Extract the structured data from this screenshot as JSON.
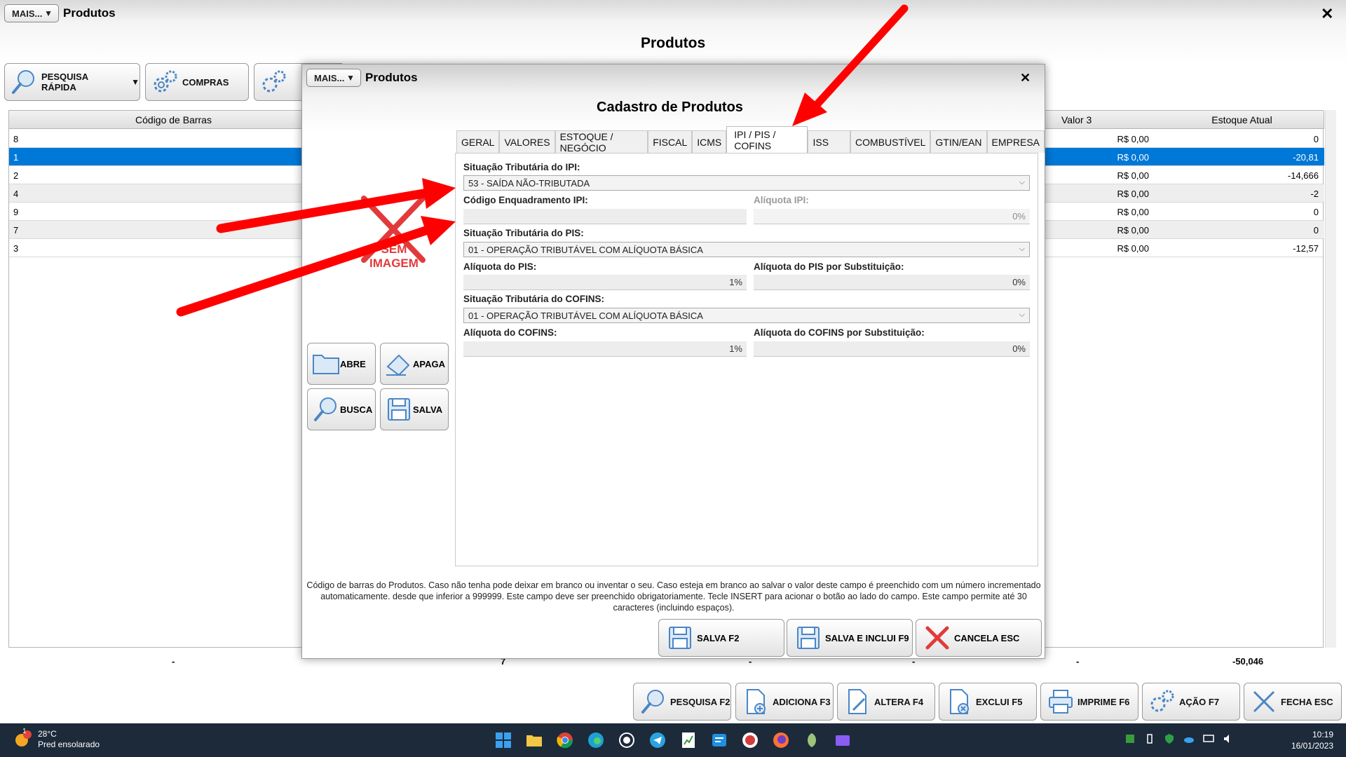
{
  "main": {
    "mais_label": "MAIS...",
    "window_title": "Produtos",
    "page_title": "Produtos",
    "toolbar": {
      "pesquisa_rapida": "PESQUISA RÁPIDA",
      "compras": "COMPRAS"
    }
  },
  "grid": {
    "headers": {
      "codigo_barras": "Código de Barras",
      "valor3": "Valor 3",
      "estoque_atual": "Estoque Atual"
    },
    "rows": [
      {
        "codigo": "8",
        "valor3": "R$ 0,00",
        "estoque": "0"
      },
      {
        "codigo": "1",
        "valor3": "R$ 0,00",
        "estoque": "-20,81"
      },
      {
        "codigo": "2",
        "valor3": "R$ 0,00",
        "estoque": "-14,666"
      },
      {
        "codigo": "4",
        "valor3": "R$ 0,00",
        "estoque": "-2"
      },
      {
        "codigo": "9",
        "valor3": "R$ 0,00",
        "estoque": "0"
      },
      {
        "codigo": "7",
        "valor3": "R$ 0,00",
        "estoque": "0"
      },
      {
        "codigo": "3",
        "valor3": "R$ 0,00",
        "estoque": "-12,57"
      }
    ],
    "totals": {
      "t1": "-",
      "t2": "7",
      "t3": "-",
      "t4": "-",
      "t5": "-",
      "t6": "-50,046"
    }
  },
  "bottom_buttons": {
    "pesquisa": "PESQUISA F2",
    "adiciona": "ADICIONA F3",
    "altera": "ALTERA F4",
    "exclui": "EXCLUI F5",
    "imprime": "IMPRIME F6",
    "acao": "AÇÃO F7",
    "fecha": "FECHA ESC"
  },
  "dialog": {
    "mais_label": "MAIS...",
    "window_title": "Produtos",
    "title": "Cadastro de Produtos",
    "tabs": [
      "GERAL",
      "VALORES",
      "ESTOQUE / NEGÓCIO",
      "FISCAL",
      "ICMS",
      "IPI / PIS / COFINS",
      "ISS",
      "COMBUSTÍVEL",
      "GTIN/EAN",
      "EMPRESA"
    ],
    "no_image_text_1": "SEM",
    "no_image_text_2": "IMAGEM",
    "side_buttons": {
      "abre": "ABRE",
      "apaga": "APAGA",
      "busca": "BUSCA",
      "salva": "SALVA"
    },
    "fields": {
      "sit_ipi_label": "Situação Tributária do IPI:",
      "sit_ipi_value": "53 - SAÍDA NÃO-TRIBUTADA",
      "cod_enq_label": "Código Enquadramento IPI:",
      "cod_enq_value": "",
      "aliq_ipi_label": "Alíquota IPI:",
      "aliq_ipi_value": "0%",
      "sit_pis_label": "Situação Tributária do PIS:",
      "sit_pis_value": "01 - OPERAÇÃO TRIBUTÁVEL COM ALÍQUOTA BÁSICA",
      "aliq_pis_label": "Alíquota do PIS:",
      "aliq_pis_value": "1%",
      "aliq_pis_sub_label": "Alíquota do PIS por Substituição:",
      "aliq_pis_sub_value": "0%",
      "sit_cofins_label": "Situação Tributária do COFINS:",
      "sit_cofins_value": "01 - OPERAÇÃO TRIBUTÁVEL COM ALÍQUOTA BÁSICA",
      "aliq_cofins_label": "Alíquota do COFINS:",
      "aliq_cofins_value": "1%",
      "aliq_cofins_sub_label": "Alíquota do COFINS por Substituição:",
      "aliq_cofins_sub_value": "0%"
    },
    "help_text": "Código de barras do Produtos. Caso não tenha pode deixar em branco ou inventar o seu. Caso esteja em branco ao salvar o valor deste campo é preenchido com um número incrementado automaticamente. desde que inferior a 999999. Este campo deve ser preenchido obrigatoriamente. Tecle INSERT para acionar o botão ao lado do campo. Este campo permite até 30 caracteres (incluindo espaços).",
    "buttons": {
      "salva": "SALVA F2",
      "salva_inclui": "SALVA E INCLUI F9",
      "cancela": "CANCELA ESC"
    }
  },
  "taskbar": {
    "weather_badge": "1",
    "temperature": "28°C",
    "weather_desc": "Pred ensolarado",
    "time": "10:19",
    "date": "16/01/2023"
  },
  "colors": {
    "selection": "#0078d7",
    "annotation_arrow": "#ff0000",
    "taskbar": "#1c2a3a"
  }
}
